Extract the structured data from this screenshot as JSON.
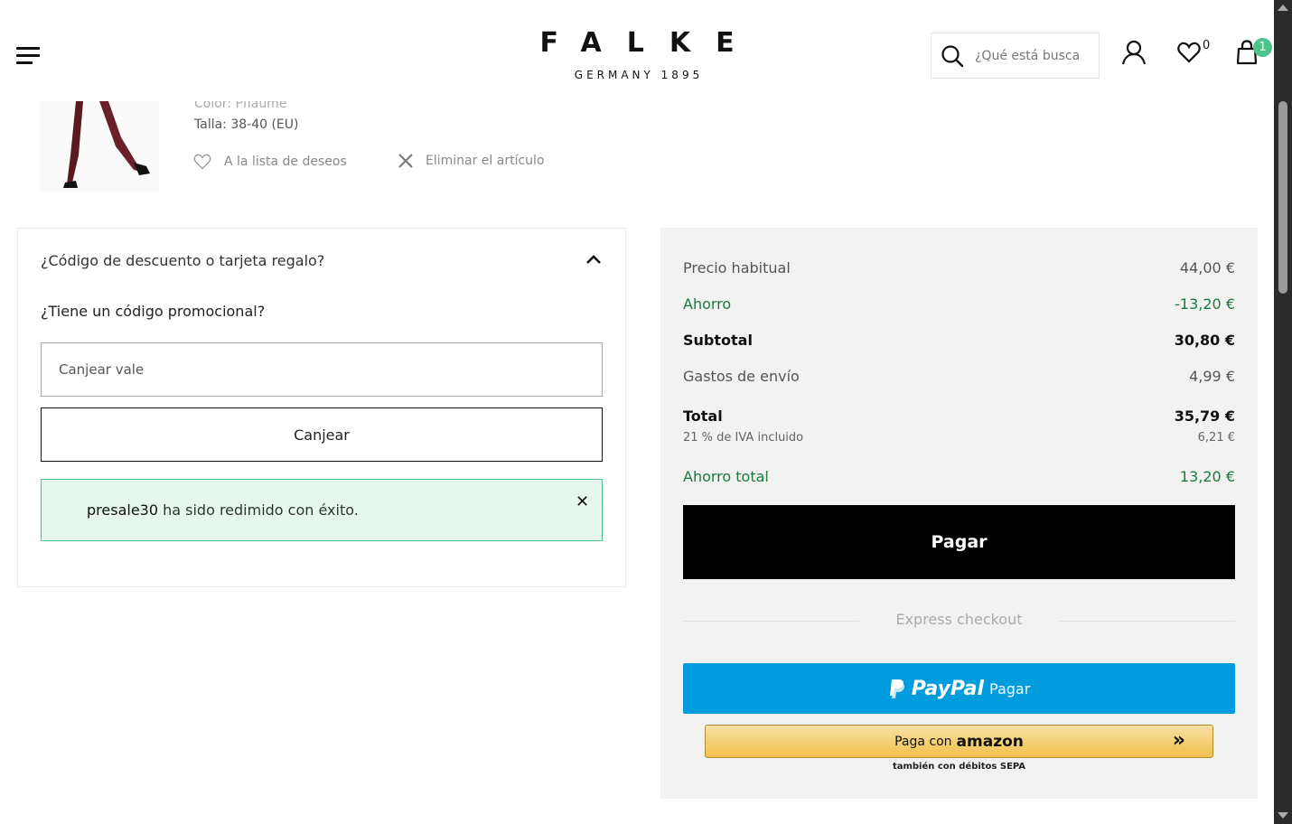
{
  "header": {
    "logo_main": "FALKE",
    "logo_sub": "GERMANY 1895",
    "search_placeholder": "¿Qué está buscando?",
    "wishlist_count": "0",
    "cart_count": "1"
  },
  "product": {
    "color_line": "Color: Pflaume",
    "size_line": "Talla: 38-40 (EU)",
    "wishlist_label": "A la lista de deseos",
    "remove_label": "Eliminar el artículo"
  },
  "discount": {
    "heading": "¿Código de descuento o tarjeta regalo?",
    "promo_question": "¿Tiene un código promocional?",
    "voucher_placeholder": "Canjear vale",
    "redeem_label": "Canjear",
    "success_code": "presale30",
    "success_text": " ha sido redimido con éxito."
  },
  "summary": {
    "regular_label": "Precio habitual",
    "regular_value": "44,00 €",
    "saving_label": "Ahorro",
    "saving_value": "-13,20 €",
    "subtotal_label": "Subtotal",
    "subtotal_value": "30,80 €",
    "shipping_label": "Gastos de envío",
    "shipping_value": "4,99 €",
    "total_label": "Total",
    "total_value": "35,79 €",
    "vat_label": "21 % de IVA incluido",
    "vat_value": "6,21 €",
    "total_saving_label": "Ahorro total",
    "total_saving_value": "13,20 €",
    "pay_label": "Pagar",
    "express_label": "Express checkout",
    "paypal_word": "PayPal",
    "paypal_pay": "Pagar",
    "amazon_pre": "Paga con",
    "amazon_word": "amazon",
    "amazon_note": "también con débitos SEPA"
  },
  "colors": {
    "accent_green": "#1a7a3e",
    "badge_green": "#4fc48a",
    "paypal_blue": "#009cde",
    "amazon_yellow": "#f0c14b"
  }
}
